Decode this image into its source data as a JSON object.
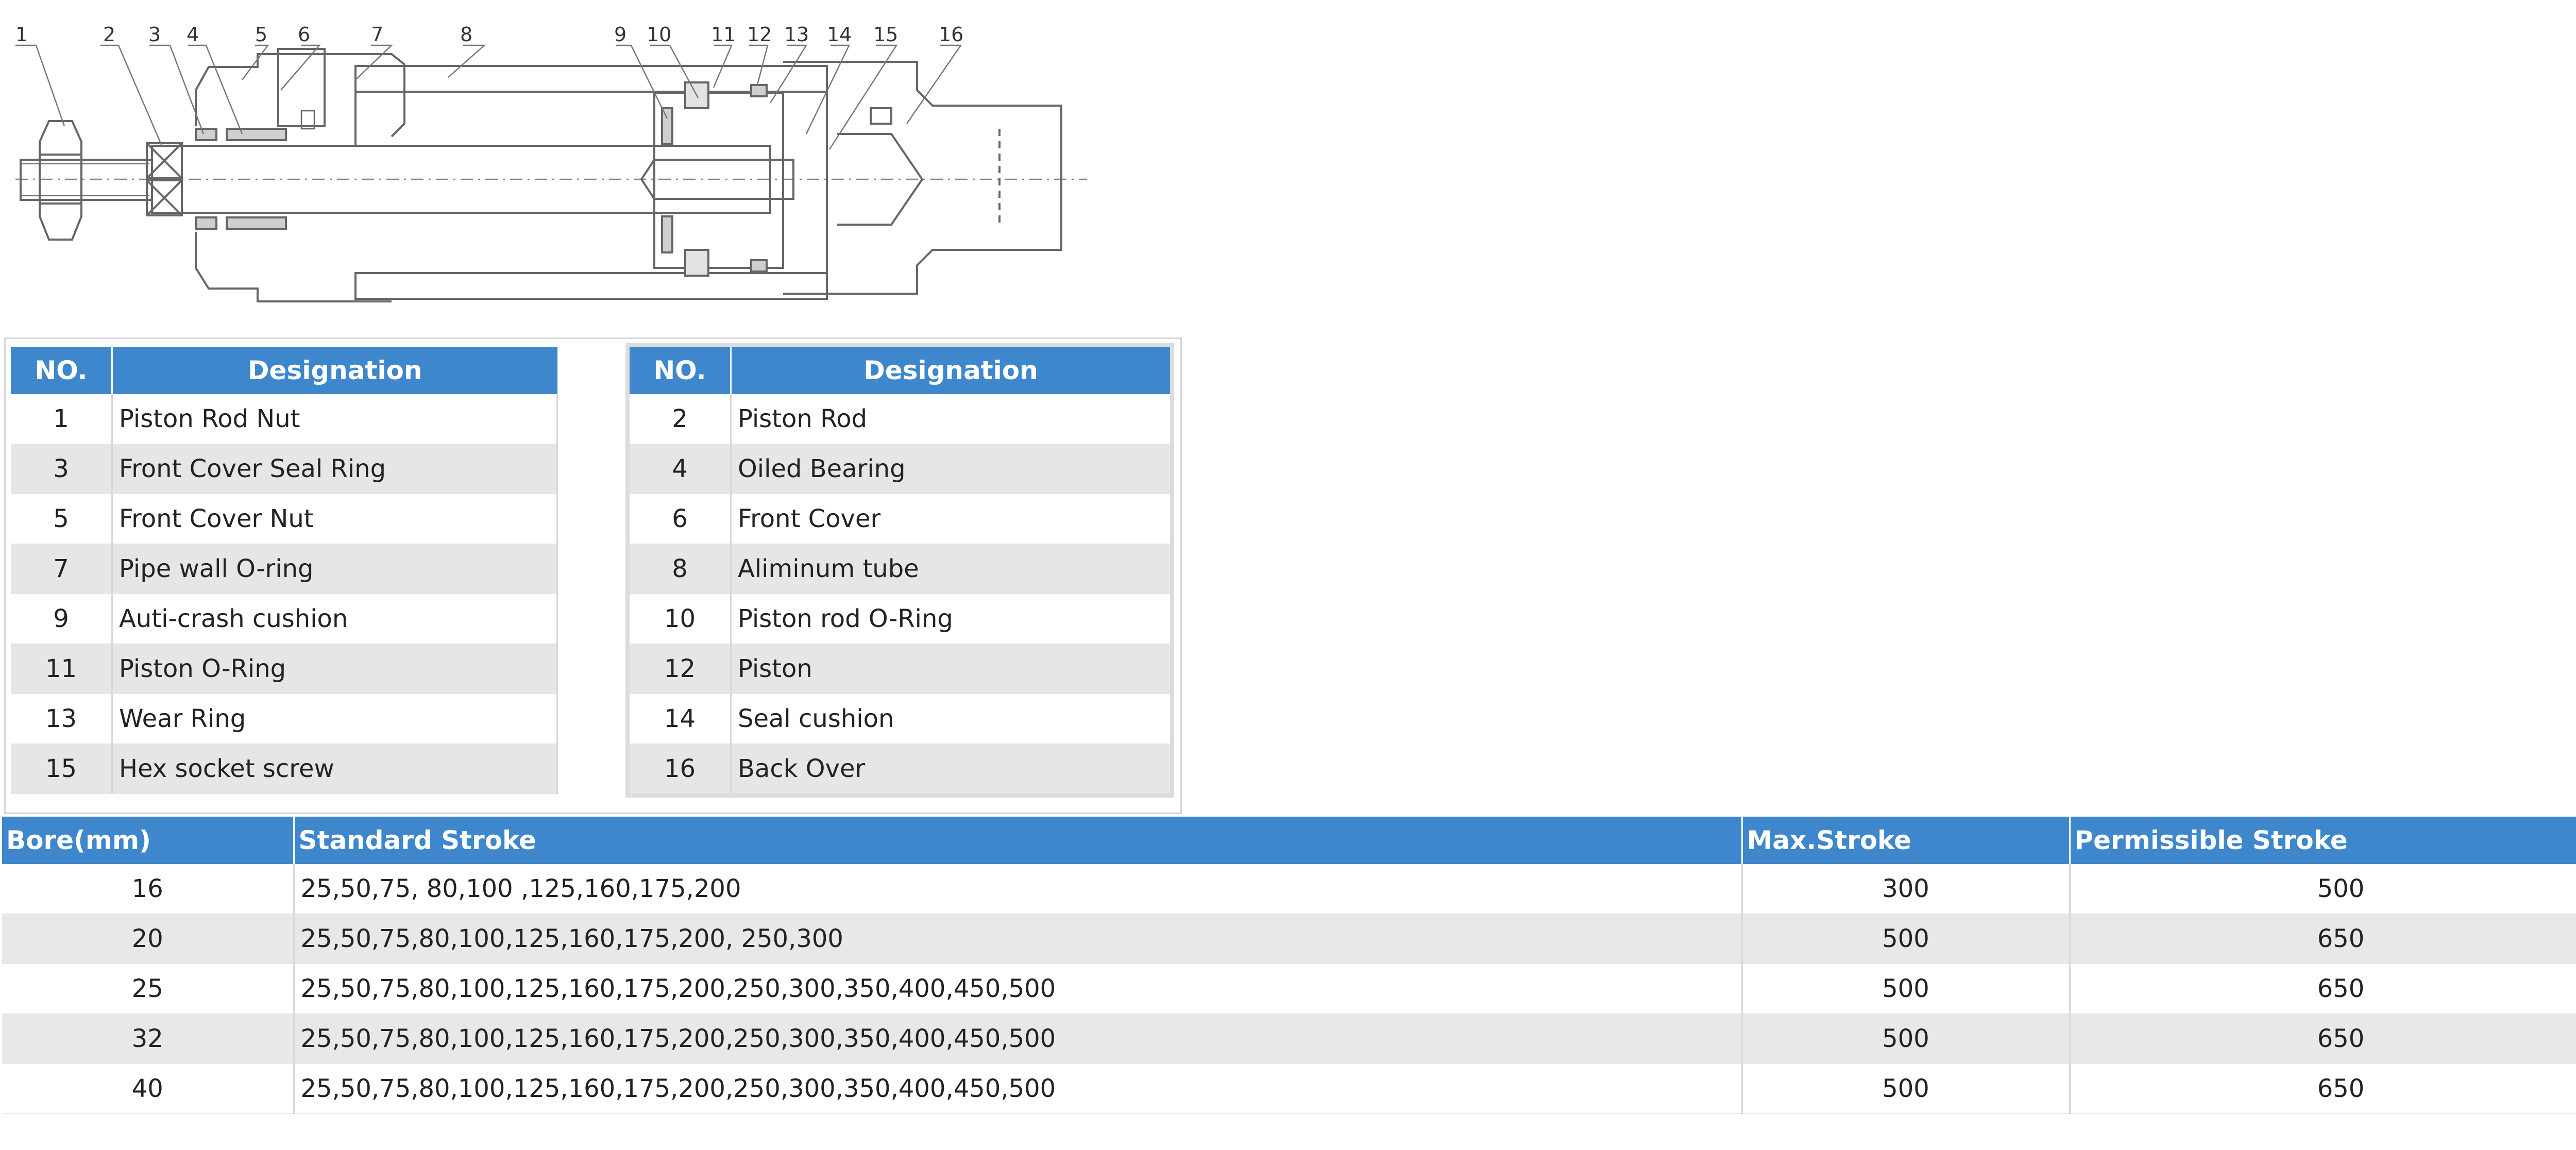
{
  "diagram": {
    "callouts": [
      "1",
      "2",
      "3",
      "4",
      "5",
      "6",
      "7",
      "8",
      "9",
      "10",
      "11",
      "12",
      "13",
      "14",
      "15",
      "16"
    ]
  },
  "parts_left": {
    "headers": {
      "no": "NO.",
      "designation": "Designation"
    },
    "rows": [
      {
        "no": "1",
        "name": "Piston Rod Nut"
      },
      {
        "no": "3",
        "name": "Front Cover Seal Ring"
      },
      {
        "no": "5",
        "name": "Front Cover Nut"
      },
      {
        "no": "7",
        "name": "Pipe wall O-ring"
      },
      {
        "no": "9",
        "name": "Auti-crash cushion"
      },
      {
        "no": "11",
        "name": "Piston O-Ring"
      },
      {
        "no": "13",
        "name": "Wear Ring"
      },
      {
        "no": "15",
        "name": "Hex socket screw"
      }
    ]
  },
  "parts_right": {
    "headers": {
      "no": "NO.",
      "designation": "Designation"
    },
    "rows": [
      {
        "no": "2",
        "name": "Piston Rod"
      },
      {
        "no": "4",
        "name": "Oiled Bearing"
      },
      {
        "no": "6",
        "name": "Front Cover"
      },
      {
        "no": "8",
        "name": "Aliminum tube"
      },
      {
        "no": "10",
        "name": "Piston rod O-Ring"
      },
      {
        "no": "12",
        "name": "Piston"
      },
      {
        "no": "14",
        "name": "Seal cushion"
      },
      {
        "no": "16",
        "name": "Back Over"
      }
    ]
  },
  "stroke_table": {
    "headers": {
      "bore": "Bore(mm)",
      "standard": "Standard Stroke",
      "max": "Max.Stroke",
      "permissible": "Permissible Stroke"
    },
    "rows": [
      {
        "bore": "16",
        "standard": "25,50,75, 80,100 ,125,160,175,200",
        "max": "300",
        "permissible": "500"
      },
      {
        "bore": "20",
        "standard": "25,50,75,80,100,125,160,175,200, 250,300",
        "max": "500",
        "permissible": "650"
      },
      {
        "bore": "25",
        "standard": "25,50,75,80,100,125,160,175,200,250,300,350,400,450,500",
        "max": "500",
        "permissible": "650"
      },
      {
        "bore": "32",
        "standard": "25,50,75,80,100,125,160,175,200,250,300,350,400,450,500",
        "max": "500",
        "permissible": "650"
      },
      {
        "bore": "40",
        "standard": "25,50,75,80,100,125,160,175,200,250,300,350,400,450,500",
        "max": "500",
        "permissible": "650"
      }
    ]
  },
  "colors": {
    "header_blue": "#3e87cc",
    "row_gray": "#e6e6e6"
  }
}
